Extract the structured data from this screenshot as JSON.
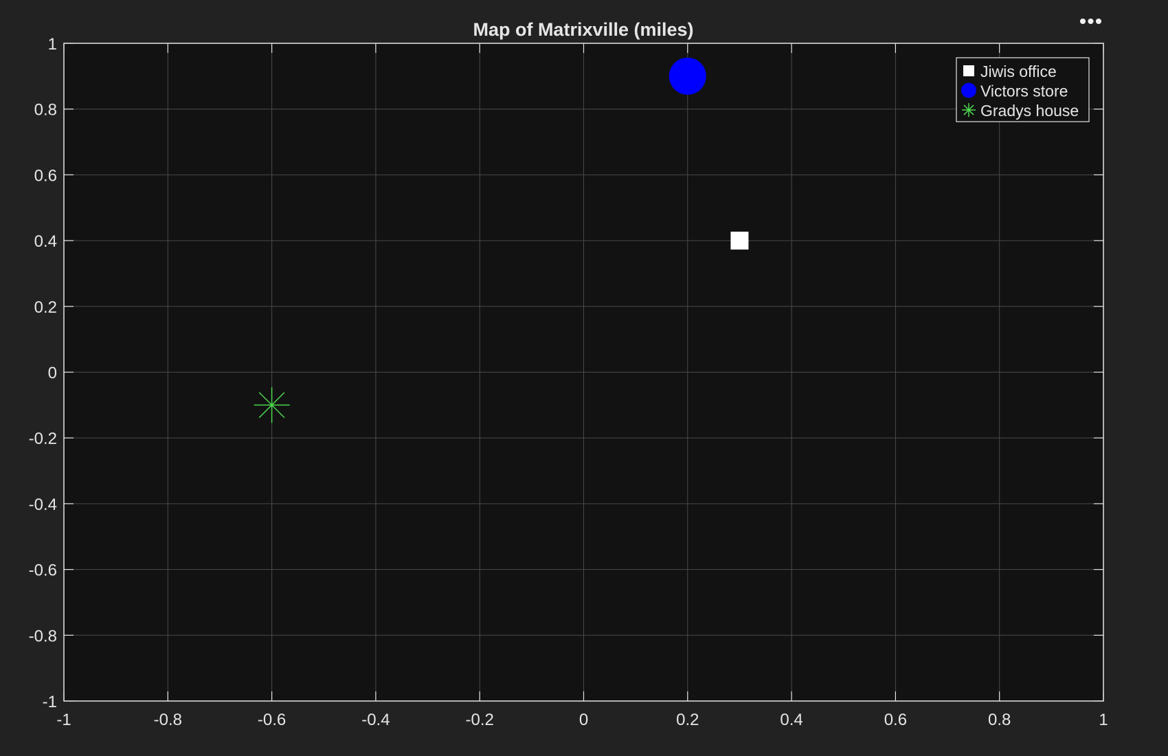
{
  "figure": {
    "menu_glyph": "•••"
  },
  "colors": {
    "background": "#222222",
    "axes_background": "#121212",
    "grid": "#4a4a4a",
    "axis_line": "#e6e6e6",
    "text": "#e6e6e6",
    "title": "#e6e6e6"
  },
  "chart_data": {
    "type": "scatter",
    "title": "Map of Matrixville (miles)",
    "xlabel": "",
    "ylabel": "",
    "xlim": [
      -1,
      1
    ],
    "ylim": [
      -1,
      1
    ],
    "xticks": [
      -1,
      -0.8,
      -0.6,
      -0.4,
      -0.2,
      0,
      0.2,
      0.4,
      0.6,
      0.8,
      1
    ],
    "yticks": [
      -1,
      -0.8,
      -0.6,
      -0.4,
      -0.2,
      0,
      0.2,
      0.4,
      0.6,
      0.8,
      1
    ],
    "xtick_labels": [
      "-1",
      "-0.8",
      "-0.6",
      "-0.4",
      "-0.2",
      "0",
      "0.2",
      "0.4",
      "0.6",
      "0.8",
      "1"
    ],
    "ytick_labels": [
      "-1",
      "-0.8",
      "-0.6",
      "-0.4",
      "-0.2",
      "0",
      "0.2",
      "0.4",
      "0.6",
      "0.8",
      "1"
    ],
    "grid": true,
    "legend_position": "top-right",
    "series": [
      {
        "name": "Jiwis office",
        "marker": "square",
        "color": "#ffffff",
        "points": [
          {
            "x": 0.3,
            "y": 0.4
          }
        ]
      },
      {
        "name": "Victors store",
        "marker": "circle",
        "color": "#0000ff",
        "points": [
          {
            "x": 0.2,
            "y": 0.9
          }
        ]
      },
      {
        "name": "Gradys house",
        "marker": "asterisk",
        "color": "#4cd94c",
        "points": [
          {
            "x": -0.6,
            "y": -0.1
          }
        ]
      }
    ]
  }
}
